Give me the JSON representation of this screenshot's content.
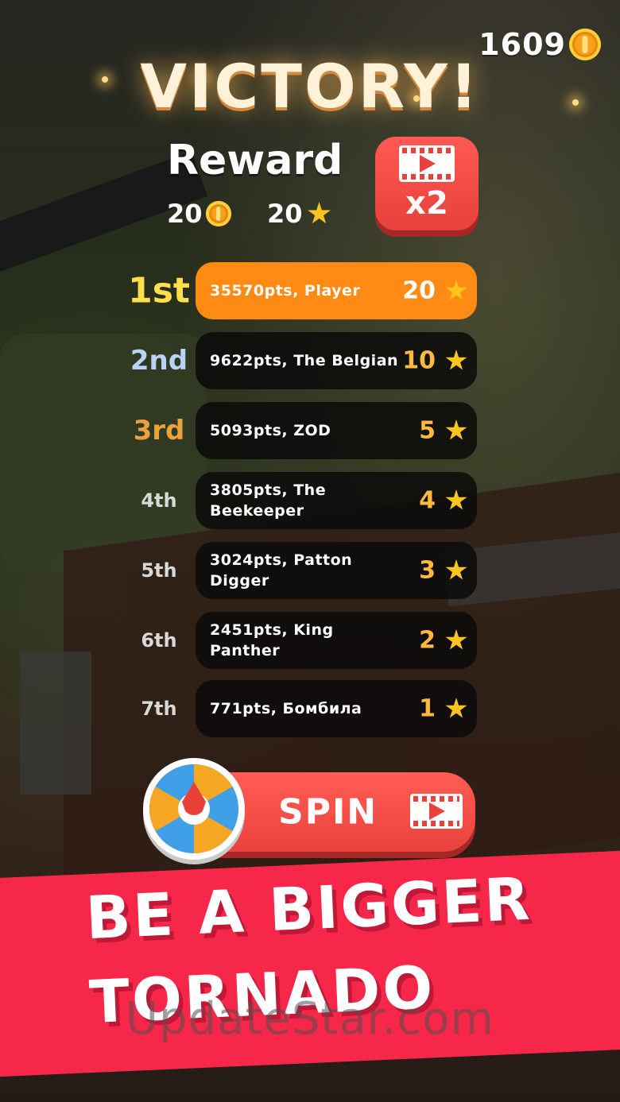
{
  "header": {
    "coin_total": "1609",
    "title": "VICTORY!"
  },
  "reward": {
    "title": "Reward",
    "coins": "20",
    "stars": "20",
    "x2_label": "x2"
  },
  "leaderboard": [
    {
      "rank": "1st",
      "entry": "35570pts, Player",
      "stars": "20",
      "rank_color": "#ffe04a",
      "highlight": true
    },
    {
      "rank": "2nd",
      "entry": "9622pts, The Belgian",
      "stars": "10",
      "rank_color": "#b9d3f5",
      "highlight": false
    },
    {
      "rank": "3rd",
      "entry": "5093pts, ZOD",
      "stars": "5",
      "rank_color": "#e9a23c",
      "highlight": false
    },
    {
      "rank": "4th",
      "entry": "3805pts, The Beekeeper",
      "stars": "4",
      "rank_color": "#d9d9d9",
      "highlight": false
    },
    {
      "rank": "5th",
      "entry": "3024pts, Patton Digger",
      "stars": "3",
      "rank_color": "#d9d9d9",
      "highlight": false
    },
    {
      "rank": "6th",
      "entry": "2451pts, King Panther",
      "stars": "2",
      "rank_color": "#d9d9d9",
      "highlight": false
    },
    {
      "rank": "7th",
      "entry": "771pts, Бомбила",
      "stars": "1",
      "rank_color": "#d9d9d9",
      "highlight": false
    }
  ],
  "spin": {
    "label": "SPIN",
    "wheel_icon": "fortune-wheel-icon",
    "video_icon": "video-ad-icon"
  },
  "banner": {
    "line1": "BE A BIGGER",
    "line2": "TORNADO"
  },
  "watermark": "UpdateStar.com",
  "colors": {
    "accent_red": "#e8403a",
    "highlight_orange": "#ff8a14",
    "banner_pink": "#f7274a",
    "star_yellow": "#ffc51e"
  }
}
